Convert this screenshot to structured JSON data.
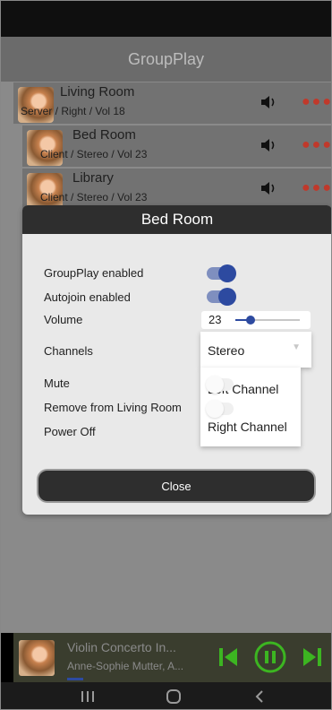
{
  "app": {
    "title": "GroupPlay"
  },
  "zones": [
    {
      "name": "Living Room",
      "detail": "Server / Right / Vol 18"
    },
    {
      "name": "Bed Room",
      "detail": "Client / Stereo / Vol 23"
    },
    {
      "name": "Library",
      "detail": "Client / Stereo / Vol 23"
    }
  ],
  "dialog": {
    "title": "Bed Room",
    "groupplay_label": "GroupPlay enabled",
    "groupplay_on": true,
    "autojoin_label": "Autojoin enabled",
    "autojoin_on": true,
    "volume_label": "Volume",
    "volume_value": "23",
    "volume_fraction": 0.23,
    "channels_label": "Channels",
    "channels_value": "Stereo",
    "channel_options": [
      "Left Channel",
      "Right Channel"
    ],
    "mute_label": "Mute",
    "mute_on": false,
    "remove_label": "Remove from Living Room",
    "remove_on": false,
    "power_label": "Power Off",
    "close_label": "Close"
  },
  "now_playing": {
    "title": "Violin Concerto In...",
    "artist": "Anne-Sophie Mutter, A...",
    "progress": 0.12,
    "controls": [
      "skip-previous-icon",
      "pause-icon",
      "skip-next-icon"
    ]
  },
  "colors": {
    "accent_blue": "#2d4aa0",
    "player_green": "#3cb521",
    "menu_dots_red": "#c0392b"
  },
  "nav_icons": [
    "recent-apps-icon",
    "home-icon",
    "back-icon"
  ]
}
